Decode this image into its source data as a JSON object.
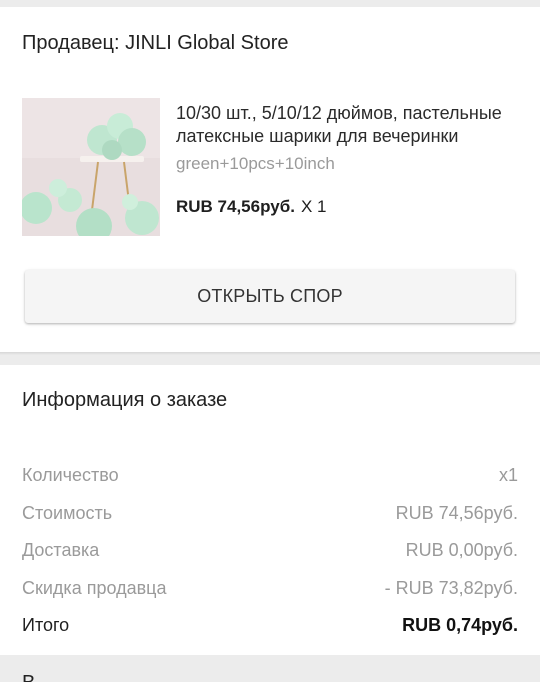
{
  "seller": {
    "label": "Продавец: JINLI Global Store"
  },
  "product": {
    "title": "10/30 шт., 5/10/12 дюймов, пастельные латексные шарики для вечеринки",
    "variant": "green+10pcs+10inch",
    "price": "RUB 74,56руб.",
    "quantity": "X 1",
    "thumbnail_icon": "balloons-photo"
  },
  "actions": {
    "open_dispute_label": "ОТКРЫТЬ СПОР"
  },
  "order_info": {
    "heading": "Информация о заказе",
    "rows": [
      {
        "label": "Количество",
        "value": "x1"
      },
      {
        "label": "Стоимость",
        "value": "RUB 74,56руб."
      },
      {
        "label": "Доставка",
        "value": "RUB 0,00руб."
      },
      {
        "label": "Скидка продавца",
        "value": "- RUB 73,82руб."
      },
      {
        "label": "Итого",
        "value": "RUB 0,74руб."
      }
    ]
  },
  "next_section": {
    "peek_text": "В"
  },
  "colors": {
    "background": "#ececec",
    "card": "#ffffff",
    "muted_text": "#9a9a9a",
    "button_bg": "#f5f5f5"
  }
}
